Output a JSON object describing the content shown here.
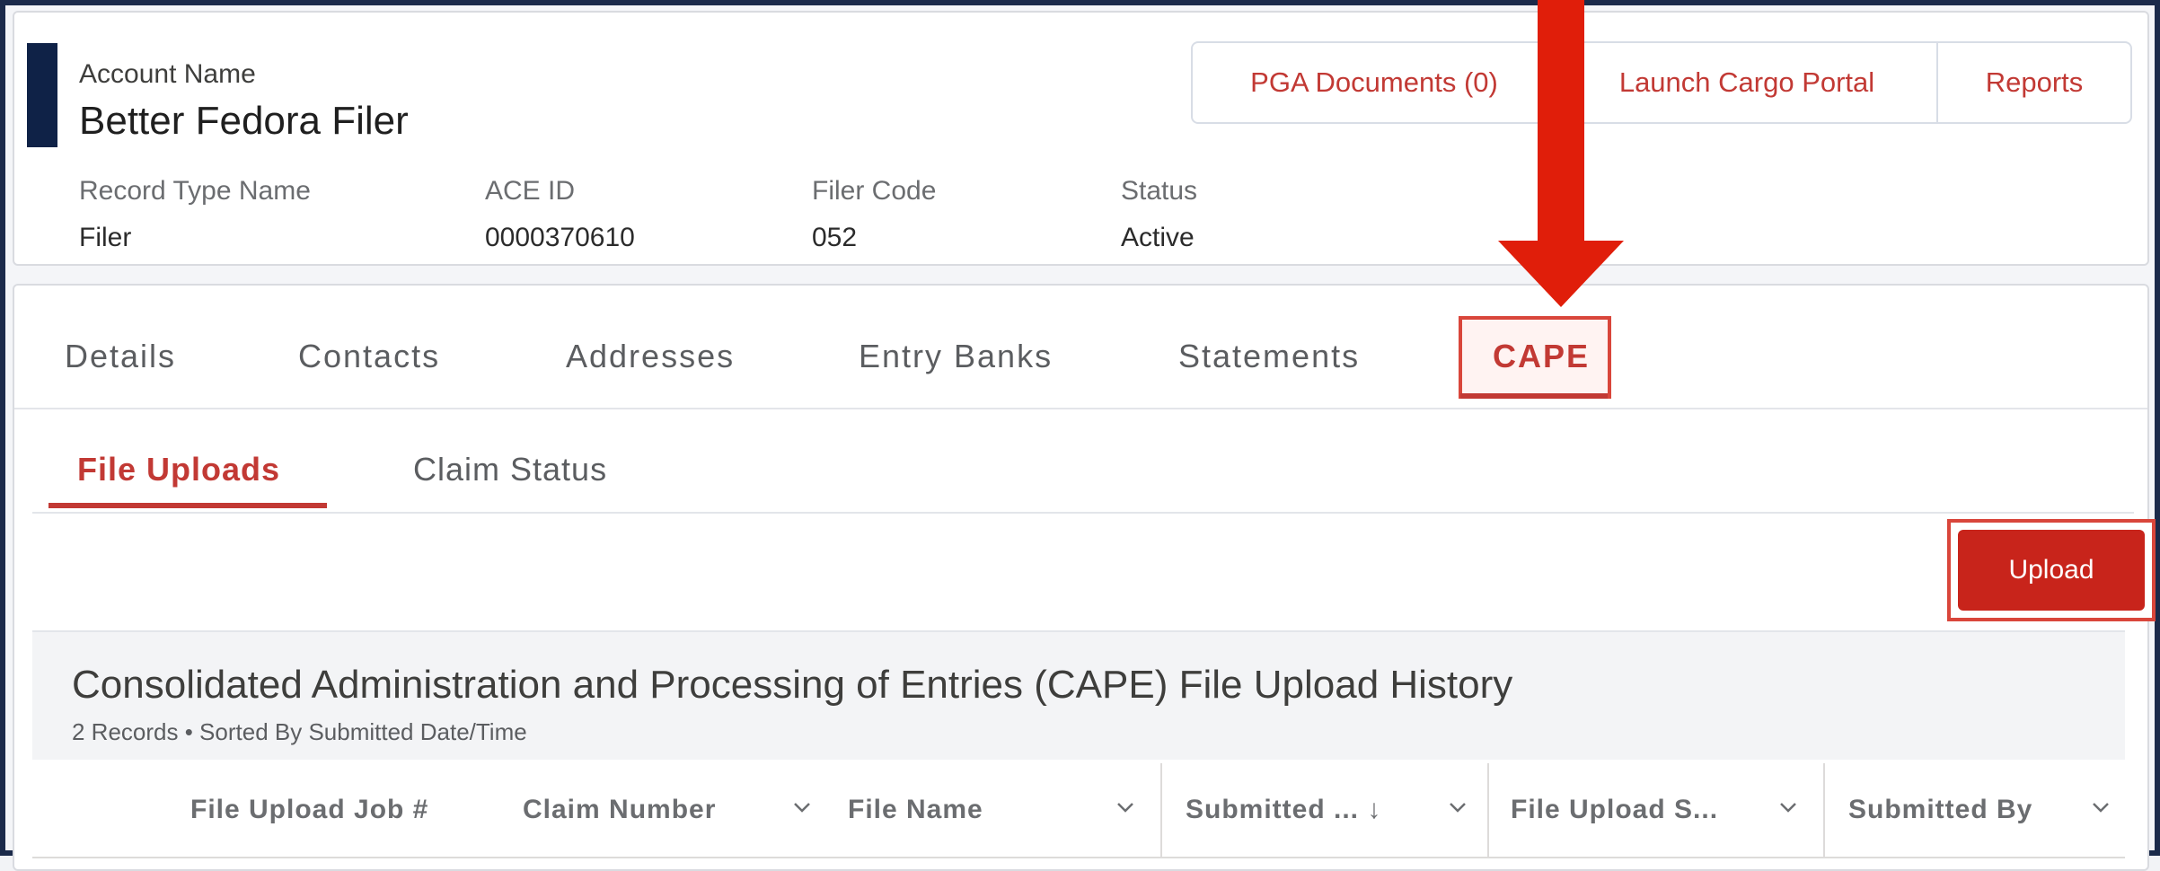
{
  "header": {
    "account_label": "Account Name",
    "account_name": "Better Fedora Filer",
    "fields": [
      {
        "label": "Record Type Name",
        "value": "Filer"
      },
      {
        "label": "ACE ID",
        "value": "0000370610"
      },
      {
        "label": "Filer Code",
        "value": "052"
      },
      {
        "label": "Status",
        "value": "Active"
      }
    ],
    "buttons": [
      "PGA Documents (0)",
      "Launch Cargo Portal",
      "Reports"
    ]
  },
  "tabs": [
    "Details",
    "Contacts",
    "Addresses",
    "Entry Banks",
    "Statements",
    "CAPE"
  ],
  "active_tab": "CAPE",
  "subtabs": [
    "File Uploads",
    "Claim Status"
  ],
  "active_subtab": "File Uploads",
  "upload_label": "Upload",
  "list": {
    "title": "Consolidated Administration and Processing of Entries (CAPE) File Upload History",
    "subtitle": "2 Records • Sorted By Submitted Date/Time",
    "columns": [
      "File Upload Job #",
      "Claim Number",
      "File Name",
      "Submitted ... ↓",
      "File Upload S...",
      "Submitted By"
    ]
  },
  "colors": {
    "accent": "#c23934",
    "upload_bg": "#c8241b",
    "arrow": "#e01e0a",
    "header_bar": "#0f2247"
  }
}
